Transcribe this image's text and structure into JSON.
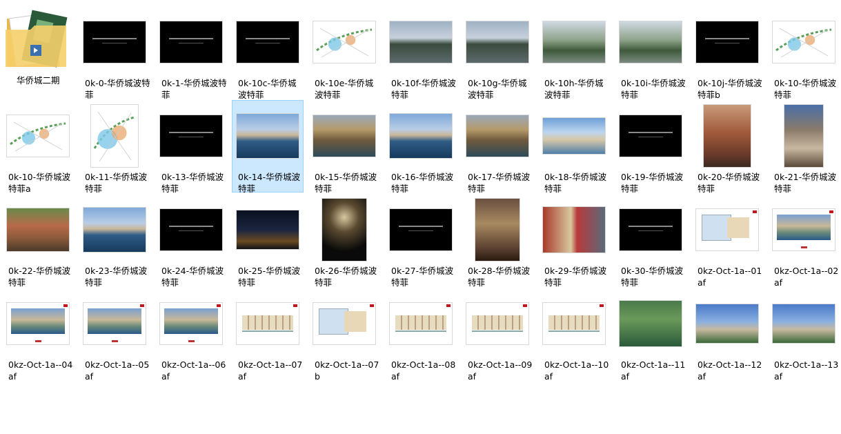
{
  "items": [
    {
      "label": "华侨城二期",
      "kind": "folder"
    },
    {
      "label": "0k-0-华侨城波特菲",
      "kind": "black"
    },
    {
      "label": "0k-1-华侨城波特菲",
      "kind": "black"
    },
    {
      "label": "0k-10c-华侨城波特菲",
      "kind": "black"
    },
    {
      "label": "0k-10e-华侨城波特菲",
      "kind": "map"
    },
    {
      "label": "0k-10f-华侨城波特菲",
      "kind": "lake"
    },
    {
      "label": "0k-10g-华侨城波特菲",
      "kind": "lake"
    },
    {
      "label": "0k-10h-华侨城波特菲",
      "kind": "palm"
    },
    {
      "label": "0k-10i-华侨城波特菲",
      "kind": "palm"
    },
    {
      "label": "0k-10j-华侨城波特菲b",
      "kind": "black"
    },
    {
      "label": "0k-10-华侨城波特菲",
      "kind": "map"
    },
    {
      "label": "0k-10-华侨城波特菲a",
      "kind": "map"
    },
    {
      "label": "0k-11-华侨城波特菲",
      "kind": "italymap"
    },
    {
      "label": "0k-13-华侨城波特菲",
      "kind": "black"
    },
    {
      "label": "0k-14-华侨城波特菲",
      "kind": "harbor",
      "selected": true
    },
    {
      "label": "0k-15-华侨城波特菲",
      "kind": "town"
    },
    {
      "label": "0k-16-华侨城波特菲",
      "kind": "harbor"
    },
    {
      "label": "0k-17-华侨城波特菲",
      "kind": "town"
    },
    {
      "label": "0k-18-华侨城波特菲",
      "kind": "beach"
    },
    {
      "label": "0k-19-华侨城波特菲",
      "kind": "black"
    },
    {
      "label": "0k-20-华侨城波特菲",
      "kind": "plaza"
    },
    {
      "label": "0k-21-华侨城波特菲",
      "kind": "street"
    },
    {
      "label": "0k-22-华侨城波特菲",
      "kind": "cafe"
    },
    {
      "label": "0k-23-华侨城波特菲",
      "kind": "harbor"
    },
    {
      "label": "0k-24-华侨城波特菲",
      "kind": "black"
    },
    {
      "label": "0k-25-华侨城波特菲",
      "kind": "night"
    },
    {
      "label": "0k-26-华侨城波特菲",
      "kind": "festival"
    },
    {
      "label": "0k-27-华侨城波特菲",
      "kind": "black"
    },
    {
      "label": "0k-28-华侨城波特菲",
      "kind": "facade"
    },
    {
      "label": "0k-29-华侨城波特菲",
      "kind": "alley"
    },
    {
      "label": "0k-30-华侨城波特菲",
      "kind": "black"
    },
    {
      "label": "0kz-Oct-1a--01af",
      "kind": "plan"
    },
    {
      "label": "0kz-Oct-1a--02af",
      "kind": "render"
    },
    {
      "label": "0kz-Oct-1a--04af",
      "kind": "render"
    },
    {
      "label": "0kz-Oct-1a--05af",
      "kind": "render"
    },
    {
      "label": "0kz-Oct-1a--06af",
      "kind": "render"
    },
    {
      "label": "0kz-Oct-1a--07af",
      "kind": "elev"
    },
    {
      "label": "0kz-Oct-1a--07b",
      "kind": "plan"
    },
    {
      "label": "0kz-Oct-1a--08af",
      "kind": "elev"
    },
    {
      "label": "0kz-Oct-1a--09af",
      "kind": "elev"
    },
    {
      "label": "0kz-Oct-1a--10af",
      "kind": "elev"
    },
    {
      "label": "0kz-Oct-1a--11af",
      "kind": "aerial"
    },
    {
      "label": "0kz-Oct-1a--12af",
      "kind": "tower"
    },
    {
      "label": "0kz-Oct-1a--13af",
      "kind": "tower"
    }
  ]
}
